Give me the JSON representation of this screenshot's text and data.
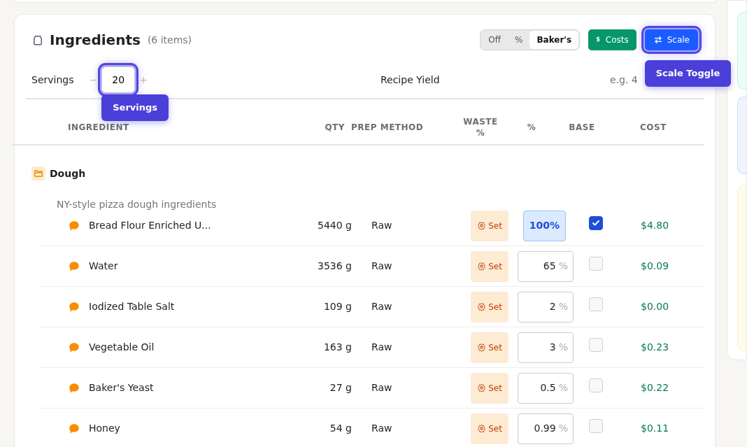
{
  "card": {
    "title": "Ingredients",
    "count": "(6 items)"
  },
  "percent_mode": {
    "options": [
      {
        "label": "Off",
        "selected": false
      },
      {
        "label": "%",
        "selected": false
      },
      {
        "label": "Baker's",
        "selected": true
      }
    ]
  },
  "costs_button": {
    "icon_text": "$",
    "label": "Costs"
  },
  "scale_button": {
    "label": "Scale",
    "focused": true,
    "tooltip": "Scale Toggle"
  },
  "servings": {
    "label": "Servings",
    "minus": "−",
    "value": "20",
    "plus": "+",
    "focused": true,
    "tooltip": "Servings"
  },
  "recipe_yield": {
    "label": "Recipe Yield",
    "placeholder": "e.g. 4"
  },
  "table": {
    "columns": [
      "INGREDIENT",
      "QTY",
      "PREP METHOD",
      "WASTE %",
      "%",
      "BASE",
      "COST"
    ]
  },
  "groups": [
    {
      "name": "Dough",
      "description": "NY-style pizza dough ingredients",
      "rows": [
        {
          "name": "Bread Flour Enriched U...",
          "qty": "5440 g",
          "prep": "Raw",
          "waste": "Set",
          "percent": "100%",
          "base": true,
          "cost": "$4.80"
        },
        {
          "name": "Water",
          "qty": "3536 g",
          "prep": "Raw",
          "waste": "Set",
          "percent": "65",
          "unit": "%",
          "base": false,
          "cost": "$0.09"
        },
        {
          "name": "Iodized Table Salt",
          "qty": "109 g",
          "prep": "Raw",
          "waste": "Set",
          "percent": "2",
          "unit": "%",
          "base": false,
          "cost": "$0.00"
        },
        {
          "name": "Vegetable Oil",
          "qty": "163 g",
          "prep": "Raw",
          "waste": "Set",
          "percent": "3",
          "unit": "%",
          "base": false,
          "cost": "$0.23"
        },
        {
          "name": "Baker's Yeast",
          "qty": "27 g",
          "prep": "Raw",
          "waste": "Set",
          "percent": "0.5",
          "unit": "%",
          "base": false,
          "cost": "$0.22"
        },
        {
          "name": "Honey",
          "qty": "54 g",
          "prep": "Raw",
          "waste": "Set",
          "percent": "0.99",
          "unit": "%",
          "base": false,
          "cost": "$0.11"
        }
      ]
    }
  ]
}
